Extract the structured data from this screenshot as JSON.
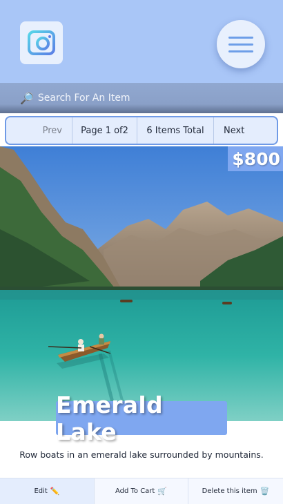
{
  "header": {
    "logo_icon": "camera-icon",
    "menu_icon": "hamburger-menu-icon"
  },
  "search": {
    "icon": "magnifier-icon",
    "placeholder": "Search For An Item"
  },
  "pagination": {
    "prev_label": "Prev",
    "page_label": "Page 1 of2",
    "total_label": "6 Items Total",
    "next_label": "Next"
  },
  "item": {
    "price": "$800",
    "title": "Emerald Lake",
    "description": "Row boats in an emerald lake surrounded by mountains."
  },
  "actions": {
    "edit_label": "Edit",
    "edit_icon": "✏️",
    "cart_label": "Add To Cart",
    "cart_icon": "🛒",
    "delete_label": "Delete this item",
    "delete_icon": "🗑️"
  },
  "colors": {
    "header_bg": "#a9c6f7",
    "accent": "#7fa7f0",
    "pager_bg": "#e4edfd",
    "pager_border": "#6f9ae6"
  }
}
